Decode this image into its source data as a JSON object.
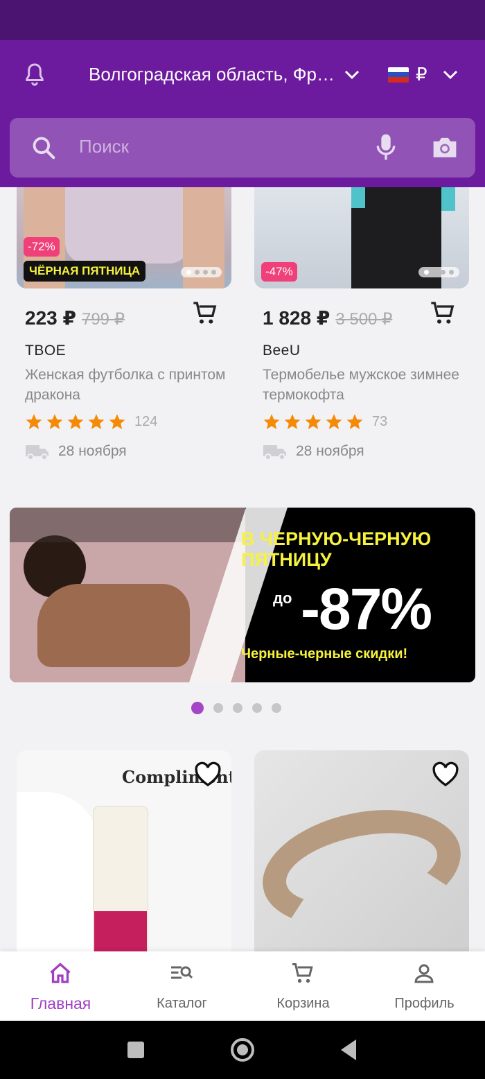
{
  "header": {
    "location": "Волгоградская область, Фр…",
    "currency": "₽",
    "search_placeholder": "Поиск"
  },
  "products_top": [
    {
      "discount": "-72%",
      "promo_badge": "ЧЁРНАЯ ПЯТНИЦА",
      "price": "223 ₽",
      "old_price": "799 ₽",
      "brand": "TBOE",
      "title": "Женская футболка с принтом дракона",
      "rating_count": "124",
      "delivery": "28 ноября"
    },
    {
      "discount": "-47%",
      "price": "1 828 ₽",
      "old_price": "3 500 ₽",
      "brand": "BeeU",
      "title": "Термобелье мужское зимнее термокофта",
      "rating_count": "73",
      "delivery": "28 ноября"
    }
  ],
  "banner": {
    "headline": "В ЧЕРНУЮ-ЧЕРНУЮ ПЯТНИЦУ",
    "prefix": "до",
    "discount": "-87%",
    "subline": "Черные-черные скидки!"
  },
  "products_bottom": [
    {
      "brand_logo": "Compliment"
    },
    {
      "brand_logo": ""
    }
  ],
  "bottom_nav": [
    {
      "label": "Главная",
      "icon": "home-icon",
      "active": true
    },
    {
      "label": "Каталог",
      "icon": "catalog-search-icon",
      "active": false
    },
    {
      "label": "Корзина",
      "icon": "cart-icon",
      "active": false
    },
    {
      "label": "Профиль",
      "icon": "profile-icon",
      "active": false
    }
  ],
  "colors": {
    "brand_purple": "#6d1b9e",
    "status_purple": "#4a1470",
    "accent": "#a13ec4",
    "discount_pink": "#f0407a",
    "star": "#f58a07",
    "bf_yellow": "#f6f23e"
  }
}
